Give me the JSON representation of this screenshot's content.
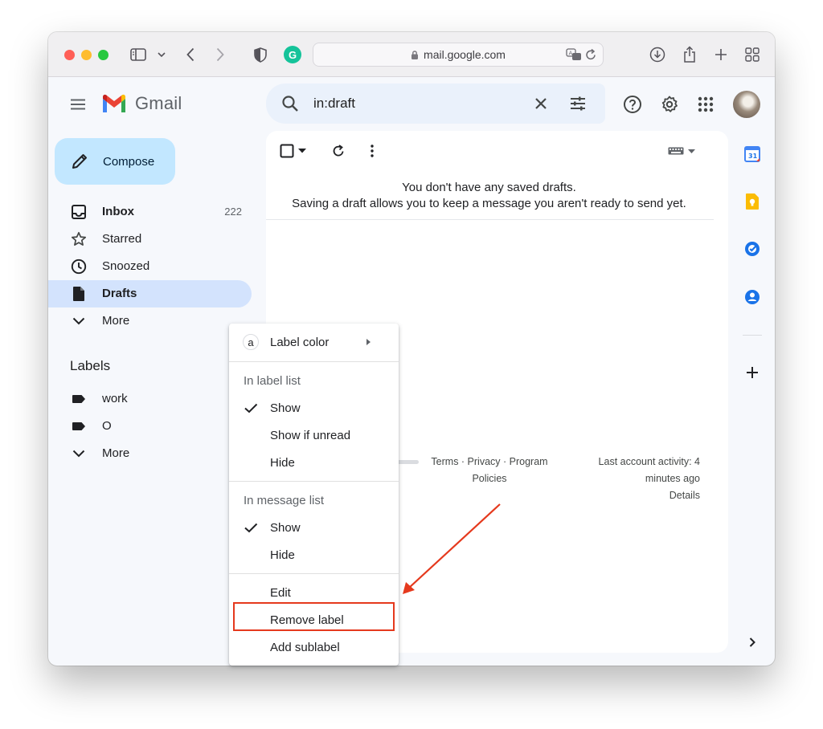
{
  "browser": {
    "url": "mail.google.com"
  },
  "app": {
    "name": "Gmail"
  },
  "search": {
    "value": "in:draft"
  },
  "compose": {
    "label": "Compose"
  },
  "sidebar": {
    "items": [
      {
        "label": "Inbox",
        "count": "222",
        "icon": "inbox-icon"
      },
      {
        "label": "Starred",
        "icon": "star-icon"
      },
      {
        "label": "Snoozed",
        "icon": "clock-icon"
      },
      {
        "label": "Drafts",
        "icon": "draft-icon"
      },
      {
        "label": "More",
        "icon": "chevron-down-icon"
      }
    ],
    "labels_title": "Labels",
    "labels": [
      {
        "label": "work",
        "icon": "label-icon"
      },
      {
        "label": "O",
        "icon": "label-icon"
      },
      {
        "label": "More",
        "icon": "chevron-down-icon"
      }
    ]
  },
  "main": {
    "empty_title": "You don't have any saved drafts.",
    "empty_subtitle": "Saving a draft allows you to keep a message you aren't ready to send yet.",
    "footer_links_line1": "Terms · Privacy · Program",
    "footer_links_line2": "Policies",
    "activity_line1": "Last account activity: 4",
    "activity_line2": "minutes ago",
    "details_link": "Details"
  },
  "context_menu": {
    "label_color": "Label color",
    "label_color_chip": "a",
    "section_label_list": "In label list",
    "label_list_options": [
      "Show",
      "Show if unread",
      "Hide"
    ],
    "label_list_selected": 0,
    "section_message_list": "In message list",
    "message_list_options": [
      "Show",
      "Hide"
    ],
    "message_list_selected": 0,
    "edit": "Edit",
    "remove_label": "Remove label",
    "add_sublabel": "Add sublabel"
  },
  "colors": {
    "compose_bg": "#c2e7ff",
    "active_nav": "#d3e3fd",
    "search_bg": "#eaf1fb",
    "annotation_red": "#e5391d"
  }
}
